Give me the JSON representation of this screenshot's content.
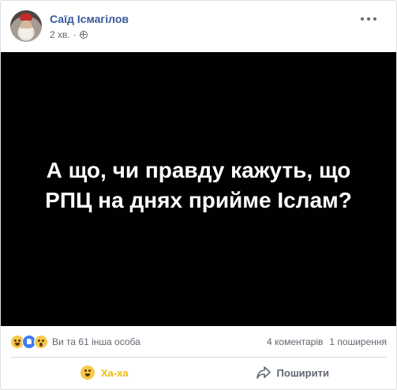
{
  "post": {
    "author_name": "Саїд Ісмагілов",
    "timestamp": "2 хв.",
    "separator": "·",
    "privacy_icon": "globe-icon",
    "image_text_line1": "А що, чи правду кажуть, що",
    "image_text_line2": "РПЦ на днях прийме Іслам?"
  },
  "stats": {
    "reaction_icons": [
      "haha-icon",
      "like-icon",
      "wow-icon"
    ],
    "reactions_text": "Ви та 61 інша особа",
    "comments": "4 коментарів",
    "shares": "1 поширення"
  },
  "actions": {
    "reaction_label": "Ха-ха",
    "share_label": "Поширити"
  },
  "colors": {
    "author": "#365899",
    "reaction_active": "#f0ba15",
    "image_background": "#010101"
  }
}
